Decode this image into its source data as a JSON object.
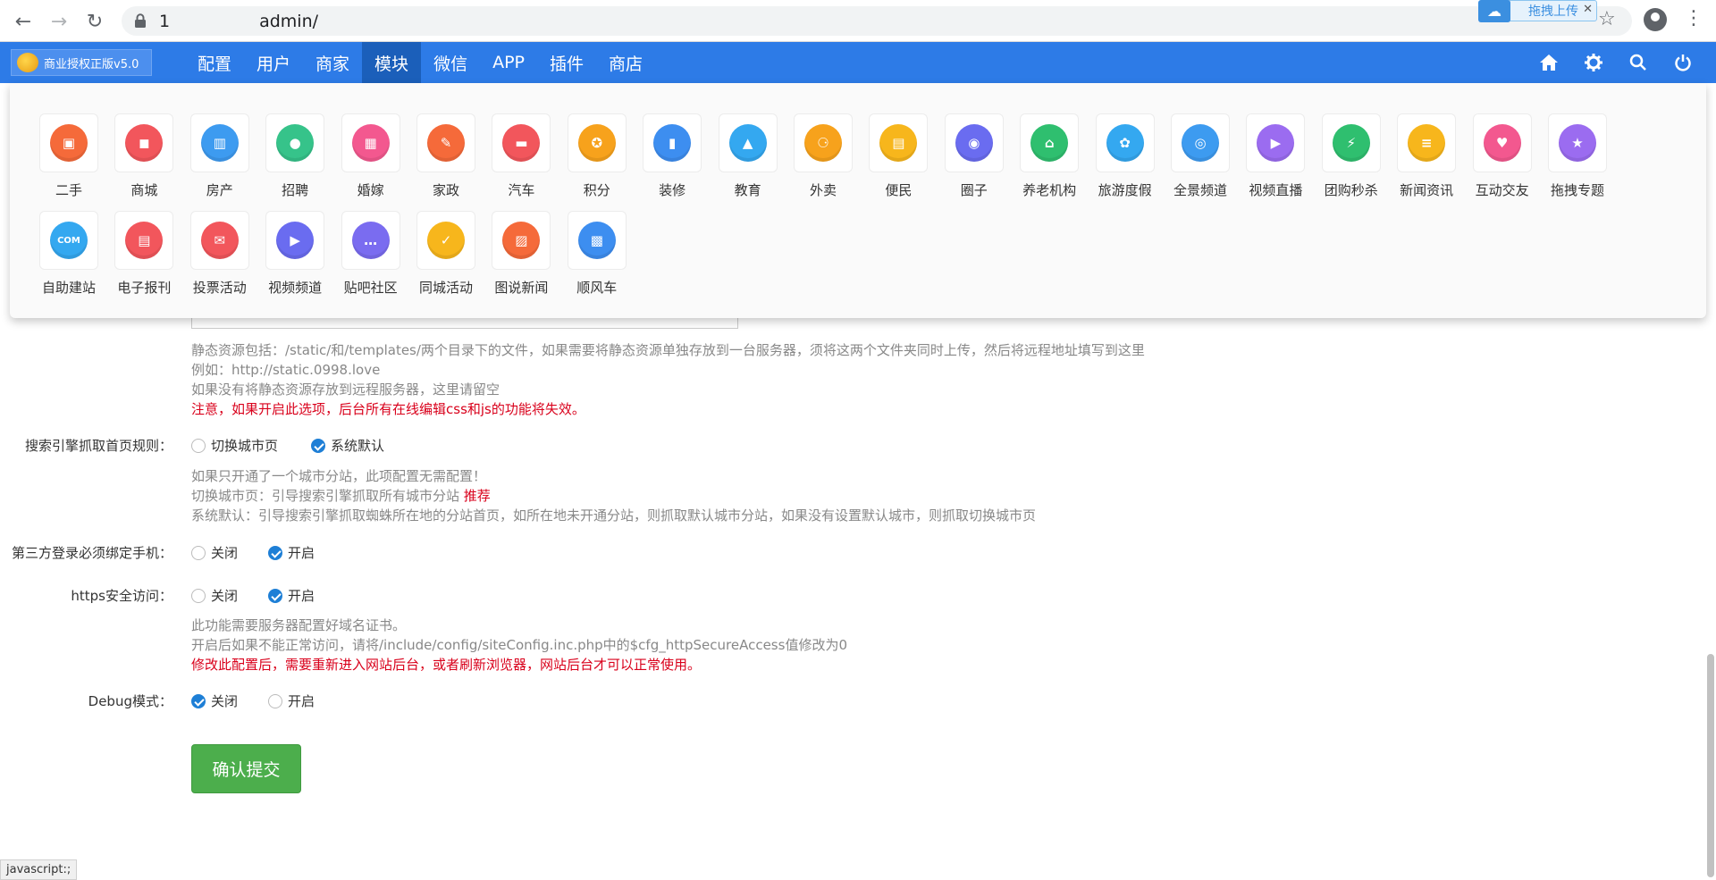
{
  "browser": {
    "url_visible_start": "1",
    "url_visible_end": "admin/",
    "upload_widget_label": "拖拽上传"
  },
  "topnav": {
    "brand": "商业授权正版v5.0",
    "menu": [
      {
        "label": "配置",
        "active": false
      },
      {
        "label": "用户",
        "active": false
      },
      {
        "label": "商家",
        "active": false
      },
      {
        "label": "模块",
        "active": true
      },
      {
        "label": "微信",
        "active": false
      },
      {
        "label": "APP",
        "active": false
      },
      {
        "label": "插件",
        "active": false
      },
      {
        "label": "商店",
        "active": false
      }
    ],
    "icons": [
      "home-icon",
      "gear-icon",
      "search-icon",
      "power-icon"
    ]
  },
  "modules": [
    {
      "label": "二手",
      "icon": "box-icon",
      "color": "#f56a3a"
    },
    {
      "label": "商城",
      "icon": "bag-icon",
      "color": "#f2565c"
    },
    {
      "label": "房产",
      "icon": "building-icon",
      "color": "#3d9bf0"
    },
    {
      "label": "招聘",
      "icon": "person-icon",
      "color": "#36c38a"
    },
    {
      "label": "婚嫁",
      "icon": "hotel-icon",
      "color": "#f3588f"
    },
    {
      "label": "家政",
      "icon": "broom-icon",
      "color": "#f56a3a"
    },
    {
      "label": "汽车",
      "icon": "car-icon",
      "color": "#f2565c"
    },
    {
      "label": "积分",
      "icon": "medal-icon",
      "color": "#f7a21c"
    },
    {
      "label": "装修",
      "icon": "roller-icon",
      "color": "#3d8ef0"
    },
    {
      "label": "教育",
      "icon": "cap-icon",
      "color": "#34a8f0"
    },
    {
      "label": "外卖",
      "icon": "scooter-icon",
      "color": "#f7a21c"
    },
    {
      "label": "便民",
      "icon": "scroll-icon",
      "color": "#f7b61c"
    },
    {
      "label": "圈子",
      "icon": "ring-icon",
      "color": "#6a6cf0"
    },
    {
      "label": "养老机构",
      "icon": "house-heart-icon",
      "color": "#2fbf6f"
    },
    {
      "label": "旅游度假",
      "icon": "palm-icon",
      "color": "#34a8f0"
    },
    {
      "label": "全景频道",
      "icon": "camera-icon",
      "color": "#3d9bf0"
    },
    {
      "label": "视频直播",
      "icon": "video-camera-icon",
      "color": "#9b6cf0"
    },
    {
      "label": "团购秒杀",
      "icon": "flash-icon",
      "color": "#2fbf6f"
    },
    {
      "label": "新闻资讯",
      "icon": "note-icon",
      "color": "#f7b61c"
    },
    {
      "label": "互动交友",
      "icon": "heart-icon",
      "color": "#f3588f"
    },
    {
      "label": "拖拽专题",
      "icon": "star-box-icon",
      "color": "#9b6cf0"
    },
    {
      "label": "自助建站",
      "icon": "monitor-com-icon",
      "color": "#34a8f0"
    },
    {
      "label": "电子报刊",
      "icon": "document-icon",
      "color": "#f2565c"
    },
    {
      "label": "投票活动",
      "icon": "ballot-icon",
      "color": "#f2565c"
    },
    {
      "label": "视频频道",
      "icon": "play-icon",
      "color": "#6a6cf0"
    },
    {
      "label": "贴吧社区",
      "icon": "chat-icon",
      "color": "#7a6cf0"
    },
    {
      "label": "同城活动",
      "icon": "check-bag-icon",
      "color": "#f7b61c"
    },
    {
      "label": "图说新闻",
      "icon": "picture-icon",
      "color": "#f56a3a"
    },
    {
      "label": "顺风车",
      "icon": "bus-icon",
      "color": "#3d8ef0"
    }
  ],
  "static_help": {
    "line1": "静态资源包括：/static/和/templates/两个目录下的文件，如果需要将静态资源单独存放到一台服务器，须将这两个文件夹同时上传，然后将远程地址填写到这里",
    "line2": "例如：http://static.0998.love",
    "line3": "如果没有将静态资源存放到远程服务器，这里请留空",
    "warning": "注意，如果开启此选项，后台所有在线编辑css和js的功能将失效。"
  },
  "seo_rule": {
    "label": "搜索引擎抓取首页规则：",
    "options": [
      {
        "label": "切换城市页",
        "checked": false
      },
      {
        "label": "系统默认",
        "checked": true
      }
    ],
    "help1": "如果只开通了一个城市分站，此项配置无需配置！",
    "help2": "切换城市页：引导搜索引擎抓取所有城市分站",
    "help2_tag": "推荐",
    "help3": "系统默认：引导搜索引擎抓取蜘蛛所在地的分站首页，如所在地未开通分站，则抓取默认城市分站，如果没有设置默认城市，则抓取切换城市页"
  },
  "third_login": {
    "label": "第三方登录必须绑定手机：",
    "options": [
      {
        "label": "关闭",
        "checked": false
      },
      {
        "label": "开启",
        "checked": true
      }
    ]
  },
  "https": {
    "label": "https安全访问：",
    "options": [
      {
        "label": "关闭",
        "checked": false
      },
      {
        "label": "开启",
        "checked": true
      }
    ],
    "help1": "此功能需要服务器配置好域名证书。",
    "help2": "开启后如果不能正常访问，请将/include/config/siteConfig.inc.php中的$cfg_httpSecureAccess值修改为0",
    "warning": "修改此配置后，需要重新进入网站后台，或者刷新浏览器，网站后台才可以正常使用。"
  },
  "debug": {
    "label": "Debug模式：",
    "options": [
      {
        "label": "关闭",
        "checked": true
      },
      {
        "label": "开启",
        "checked": false
      }
    ]
  },
  "submit_label": "确认提交",
  "status_bar": "javascript:;"
}
